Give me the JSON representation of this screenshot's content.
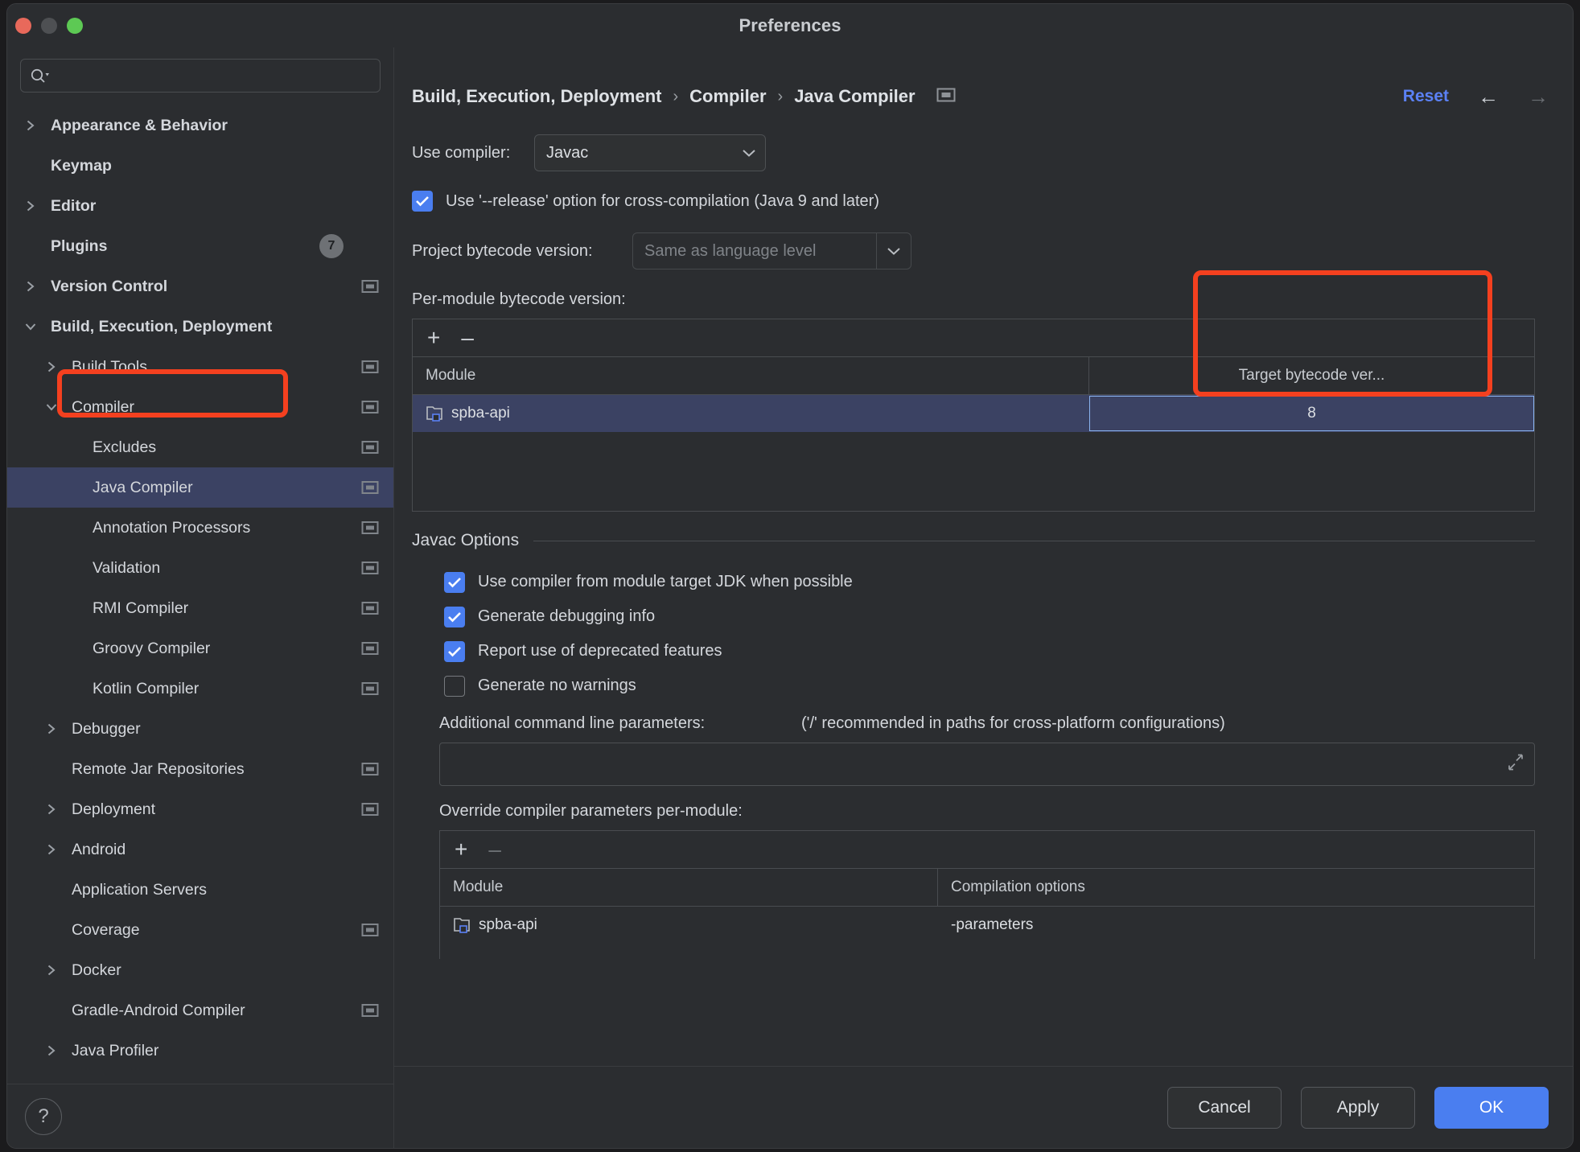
{
  "window": {
    "title": "Preferences"
  },
  "search": {
    "value": "",
    "placeholder": ""
  },
  "sidebar": {
    "items": [
      {
        "label": "Appearance & Behavior",
        "twisty": "collapsed",
        "bold": true,
        "indent": 0,
        "scope": false,
        "badge": ""
      },
      {
        "label": "Keymap",
        "twisty": "none",
        "bold": true,
        "indent": 0,
        "scope": false,
        "badge": ""
      },
      {
        "label": "Editor",
        "twisty": "collapsed",
        "bold": true,
        "indent": 0,
        "scope": false,
        "badge": ""
      },
      {
        "label": "Plugins",
        "twisty": "none",
        "bold": true,
        "indent": 0,
        "scope": false,
        "badge": "7"
      },
      {
        "label": "Version Control",
        "twisty": "collapsed",
        "bold": true,
        "indent": 0,
        "scope": true,
        "badge": ""
      },
      {
        "label": "Build, Execution, Deployment",
        "twisty": "expanded",
        "bold": true,
        "indent": 0,
        "scope": false,
        "badge": ""
      },
      {
        "label": "Build Tools",
        "twisty": "collapsed",
        "bold": false,
        "indent": 1,
        "scope": true,
        "badge": ""
      },
      {
        "label": "Compiler",
        "twisty": "expanded",
        "bold": false,
        "indent": 1,
        "scope": true,
        "badge": ""
      },
      {
        "label": "Excludes",
        "twisty": "none",
        "bold": false,
        "indent": 2,
        "scope": true,
        "badge": ""
      },
      {
        "label": "Java Compiler",
        "twisty": "none",
        "bold": false,
        "indent": 2,
        "scope": true,
        "badge": "",
        "selected": true
      },
      {
        "label": "Annotation Processors",
        "twisty": "none",
        "bold": false,
        "indent": 2,
        "scope": true,
        "badge": ""
      },
      {
        "label": "Validation",
        "twisty": "none",
        "bold": false,
        "indent": 2,
        "scope": true,
        "badge": ""
      },
      {
        "label": "RMI Compiler",
        "twisty": "none",
        "bold": false,
        "indent": 2,
        "scope": true,
        "badge": ""
      },
      {
        "label": "Groovy Compiler",
        "twisty": "none",
        "bold": false,
        "indent": 2,
        "scope": true,
        "badge": ""
      },
      {
        "label": "Kotlin Compiler",
        "twisty": "none",
        "bold": false,
        "indent": 2,
        "scope": true,
        "badge": ""
      },
      {
        "label": "Debugger",
        "twisty": "collapsed",
        "bold": false,
        "indent": 1,
        "scope": false,
        "badge": ""
      },
      {
        "label": "Remote Jar Repositories",
        "twisty": "none",
        "bold": false,
        "indent": 1,
        "scope": true,
        "badge": ""
      },
      {
        "label": "Deployment",
        "twisty": "collapsed",
        "bold": false,
        "indent": 1,
        "scope": true,
        "badge": ""
      },
      {
        "label": "Android",
        "twisty": "collapsed",
        "bold": false,
        "indent": 1,
        "scope": false,
        "badge": ""
      },
      {
        "label": "Application Servers",
        "twisty": "none",
        "bold": false,
        "indent": 1,
        "scope": false,
        "badge": ""
      },
      {
        "label": "Coverage",
        "twisty": "none",
        "bold": false,
        "indent": 1,
        "scope": true,
        "badge": ""
      },
      {
        "label": "Docker",
        "twisty": "collapsed",
        "bold": false,
        "indent": 1,
        "scope": false,
        "badge": ""
      },
      {
        "label": "Gradle-Android Compiler",
        "twisty": "none",
        "bold": false,
        "indent": 1,
        "scope": true,
        "badge": ""
      },
      {
        "label": "Java Profiler",
        "twisty": "collapsed",
        "bold": false,
        "indent": 1,
        "scope": false,
        "badge": ""
      }
    ],
    "help_label": "?"
  },
  "header": {
    "breadcrumbs": [
      "Build, Execution, Deployment",
      "Compiler",
      "Java Compiler"
    ],
    "separator": "›",
    "reset_label": "Reset",
    "back_arrow": "←",
    "forward_arrow": "→"
  },
  "main": {
    "use_compiler_label": "Use compiler:",
    "use_compiler_value": "Javac",
    "release_option_label": "Use '--release' option for cross-compilation (Java 9 and later)",
    "release_option_checked": true,
    "project_bytecode_label": "Project bytecode version:",
    "project_bytecode_value": "Same as language level",
    "per_module_label": "Per-module bytecode version:",
    "add_label": "+",
    "remove_label": "–",
    "bytecode_table": {
      "columns": [
        "Module",
        "Target bytecode ver..."
      ],
      "rows": [
        {
          "module": "spba-api",
          "target": "8",
          "selected": true,
          "editing": true
        }
      ]
    },
    "javac_options_title": "Javac Options",
    "checkboxes": [
      {
        "label": "Use compiler from module target JDK when possible",
        "checked": true
      },
      {
        "label": "Generate debugging info",
        "checked": true
      },
      {
        "label": "Report use of deprecated features",
        "checked": true
      },
      {
        "label": "Generate no warnings",
        "checked": false
      }
    ],
    "additional_params_label": "Additional command line parameters:",
    "additional_params_hint": "('/' recommended in paths for cross-platform configurations)",
    "additional_params_value": "",
    "override_label": "Override compiler parameters per-module:",
    "override_table": {
      "columns": [
        "Module",
        "Compilation options"
      ],
      "rows": [
        {
          "module": "spba-api",
          "options": "-parameters"
        }
      ]
    }
  },
  "footer": {
    "cancel_label": "Cancel",
    "apply_label": "Apply",
    "ok_label": "OK"
  },
  "colors": {
    "accent": "#4a7ef0",
    "link": "#5b81f5",
    "selection": "#3b4263",
    "annotation": "#f4401f",
    "window_bg": "#2b2d30"
  }
}
